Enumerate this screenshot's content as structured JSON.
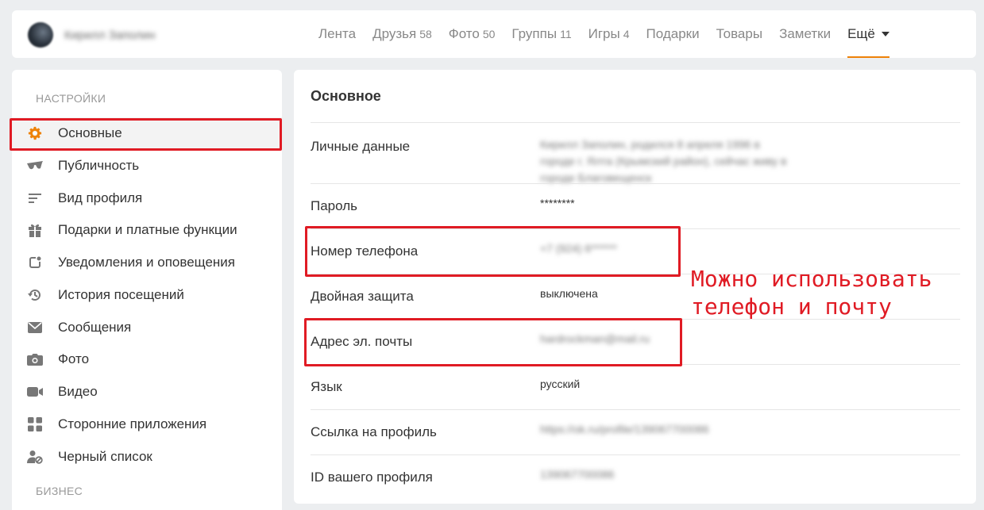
{
  "header": {
    "user_name": "Кирилл Заполин",
    "nav": [
      {
        "label": "Лента",
        "count": ""
      },
      {
        "label": "Друзья",
        "count": "58"
      },
      {
        "label": "Фото",
        "count": "50"
      },
      {
        "label": "Группы",
        "count": "11"
      },
      {
        "label": "Игры",
        "count": "4"
      },
      {
        "label": "Подарки",
        "count": ""
      },
      {
        "label": "Товары",
        "count": ""
      },
      {
        "label": "Заметки",
        "count": ""
      }
    ],
    "more_label": "Ещё",
    "accent_color": "#ee8208"
  },
  "sidebar": {
    "section_settings": "НАСТРОЙКИ",
    "items": [
      {
        "label": "Основные",
        "icon": "gear-icon"
      },
      {
        "label": "Публичность",
        "icon": "sunglasses-icon"
      },
      {
        "label": "Вид профиля",
        "icon": "lines-icon"
      },
      {
        "label": "Подарки и платные функции",
        "icon": "gift-icon"
      },
      {
        "label": "Уведомления и оповещения",
        "icon": "notification-icon"
      },
      {
        "label": "История посещений",
        "icon": "history-icon"
      },
      {
        "label": "Сообщения",
        "icon": "envelope-icon"
      },
      {
        "label": "Фото",
        "icon": "camera-icon"
      },
      {
        "label": "Видео",
        "icon": "video-icon"
      },
      {
        "label": "Сторонние приложения",
        "icon": "apps-grid-icon"
      },
      {
        "label": "Черный список",
        "icon": "blocked-user-icon"
      }
    ],
    "section_business": "БИЗНЕС"
  },
  "main": {
    "title": "Основное",
    "rows": [
      {
        "label": "Личные данные",
        "value": "Кирилл Заполин, родился 8 апреля 1996 в городе г. Ялта (Крымский район), сейчас живу в городе Благовещенск"
      },
      {
        "label": "Пароль",
        "value": "********"
      },
      {
        "label": "Номер телефона",
        "value": "+7 (924) 6******"
      },
      {
        "label": "Двойная защита",
        "value": "выключена"
      },
      {
        "label": "Адрес эл. почты",
        "value": "hardrockman@mail.ru"
      },
      {
        "label": "Язык",
        "value": "русский"
      },
      {
        "label": "Ссылка на профиль",
        "value": "https://ok.ru/profile/139067700086"
      },
      {
        "label": "ID вашего профиля",
        "value": "139067700086"
      }
    ]
  },
  "annotation": {
    "line1": "Можно использовать",
    "line2": "телефон и почту",
    "color": "#e01b24"
  }
}
